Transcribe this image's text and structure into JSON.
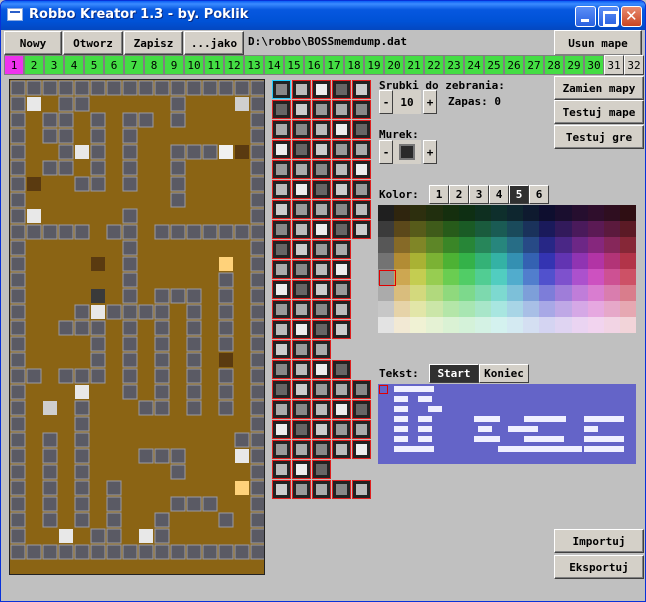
{
  "window": {
    "title": "Robbo Kreator 1.3 - by. Poklik"
  },
  "toolbar": {
    "new_label": "Nowy",
    "open_label": "Otworz",
    "save_label": "Zapisz",
    "save_as_label": "...jako",
    "path": "D:\\robbo\\BOSSmemdump.dat",
    "delete_map_label": "Usun mape"
  },
  "level_tabs": [
    "1",
    "2",
    "3",
    "4",
    "5",
    "6",
    "7",
    "8",
    "9",
    "10",
    "11",
    "12",
    "13",
    "14",
    "15",
    "16",
    "17",
    "18",
    "19",
    "20",
    "21",
    "22",
    "23",
    "24",
    "25",
    "26",
    "27",
    "28",
    "29",
    "30",
    "31",
    "32"
  ],
  "active_level": "1",
  "right_buttons": {
    "swap_maps": "Zamien mapy",
    "test_map": "Testuj mape",
    "test_game": "Testuj gre"
  },
  "screws": {
    "label": "Srubki do zebrania:",
    "value": "10",
    "minus": "-",
    "plus": "+",
    "spare_label": "Zapas: 0"
  },
  "wall": {
    "label": "Murek:",
    "minus": "-",
    "plus": "+"
  },
  "color": {
    "label": "Kolor:",
    "tabs": [
      "1",
      "2",
      "3",
      "4",
      "5",
      "6"
    ],
    "active": "5"
  },
  "text": {
    "label": "Tekst:",
    "start": "Start",
    "end": "Koniec"
  },
  "bottom_buttons": {
    "import": "Importuj",
    "export": "Eksportuj"
  },
  "colors": {
    "floor": "#8b6414",
    "wall": "#5a5a64",
    "accent_active_tab": "#ee33ee",
    "tab_green": "#44dd44",
    "text_bg": "#6464c8"
  },
  "map_grid": [
    "################",
    "#s.##.....#...c#",
    "#.##.#.##.#....#",
    "#.##.#.#.......#",
    "#..#s#.#..###tb#",
    "#.##.#.#..#....#",
    "#b..##.#..#....#",
    "#.........#....#",
    "#s.....#.......#",
    "#####.##.#######",
    "#......#.......#",
    "#....b.#.....k.#",
    "#......#.....#.#",
    "#....a.#.###.#.#",
    "#...#s####.#.#.#",
    "#..###.#.#.#.#.#",
    "#....#.#.#.#.#.#",
    "#....#.#.#.#.b.#",
    "##.###.#.#.#.#.#",
    "#...s..#.#.#.#.#",
    "#.c.#...##.#.#.#",
    "#...#..........#",
    "#.#.#.........##",
    "#.#.#...###...s#",
    "#.#.#.....#....#",
    "#.#.#.#.......k#",
    "#.#.#.#...###..#",
    "#.#.#.#..#...#.#",
    "#..s.##.s#.....#",
    "################"
  ],
  "palette_rows": 21
}
